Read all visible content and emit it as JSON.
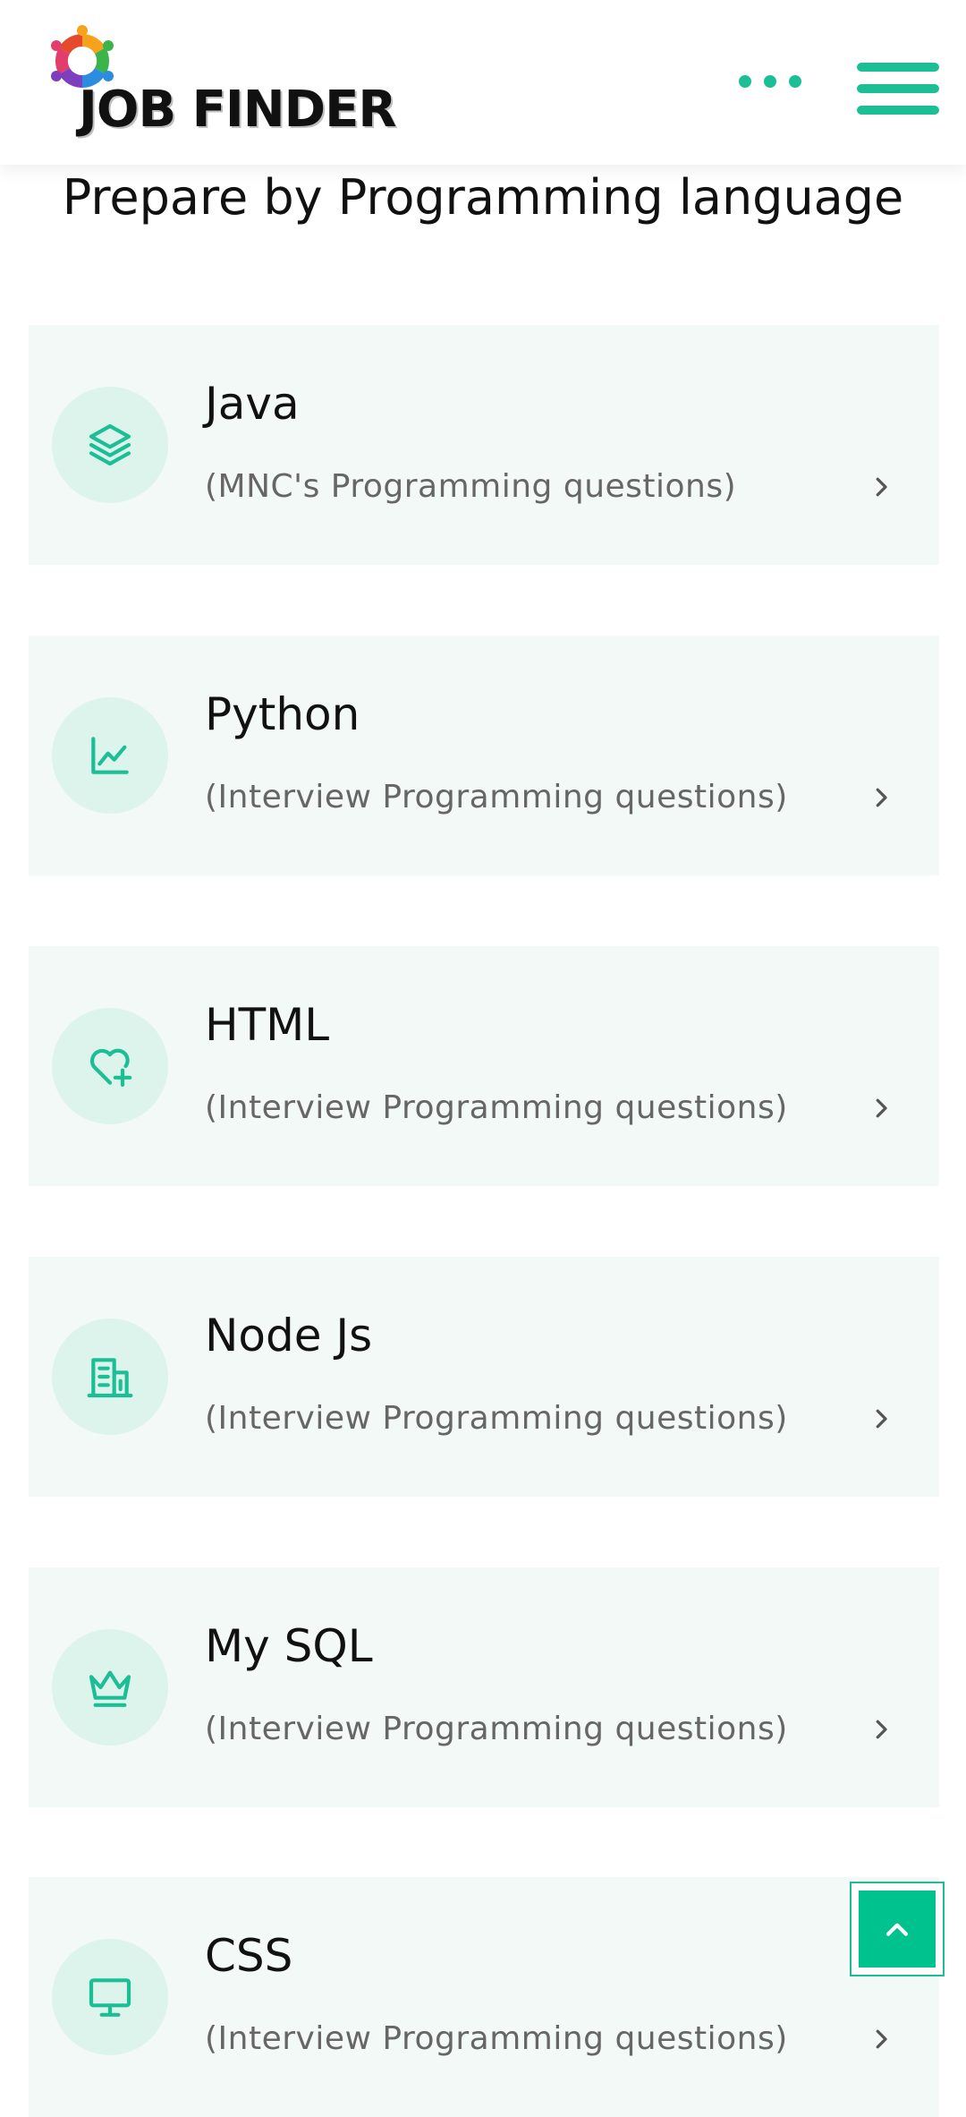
{
  "header": {
    "logo_text": "JOB FINDER",
    "more_icon": "more-dots-icon",
    "menu_icon": "hamburger-menu-icon"
  },
  "page": {
    "title": "Prepare by Programming language"
  },
  "languages": [
    {
      "title": "Java",
      "subtitle": "(MNC's Programming questions)",
      "icon": "layers-icon"
    },
    {
      "title": "Python",
      "subtitle": "(Interview Programming questions)",
      "icon": "line-chart-icon"
    },
    {
      "title": "HTML",
      "subtitle": "(Interview Programming questions)",
      "icon": "heart-plus-icon"
    },
    {
      "title": "Node Js",
      "subtitle": "(Interview Programming questions)",
      "icon": "building-icon"
    },
    {
      "title": "My SQL",
      "subtitle": "(Interview Programming questions)",
      "icon": "crown-icon"
    },
    {
      "title": "CSS",
      "subtitle": "(Interview Programming questions)",
      "icon": "monitor-icon"
    }
  ],
  "colors": {
    "accent": "#1cbf95",
    "card_bg": "#f3f9f6",
    "icon_circle_bg": "#ddf4ec",
    "scroll_top_bg": "#00c28f"
  },
  "scroll_top": {
    "icon": "chevron-up-icon"
  }
}
